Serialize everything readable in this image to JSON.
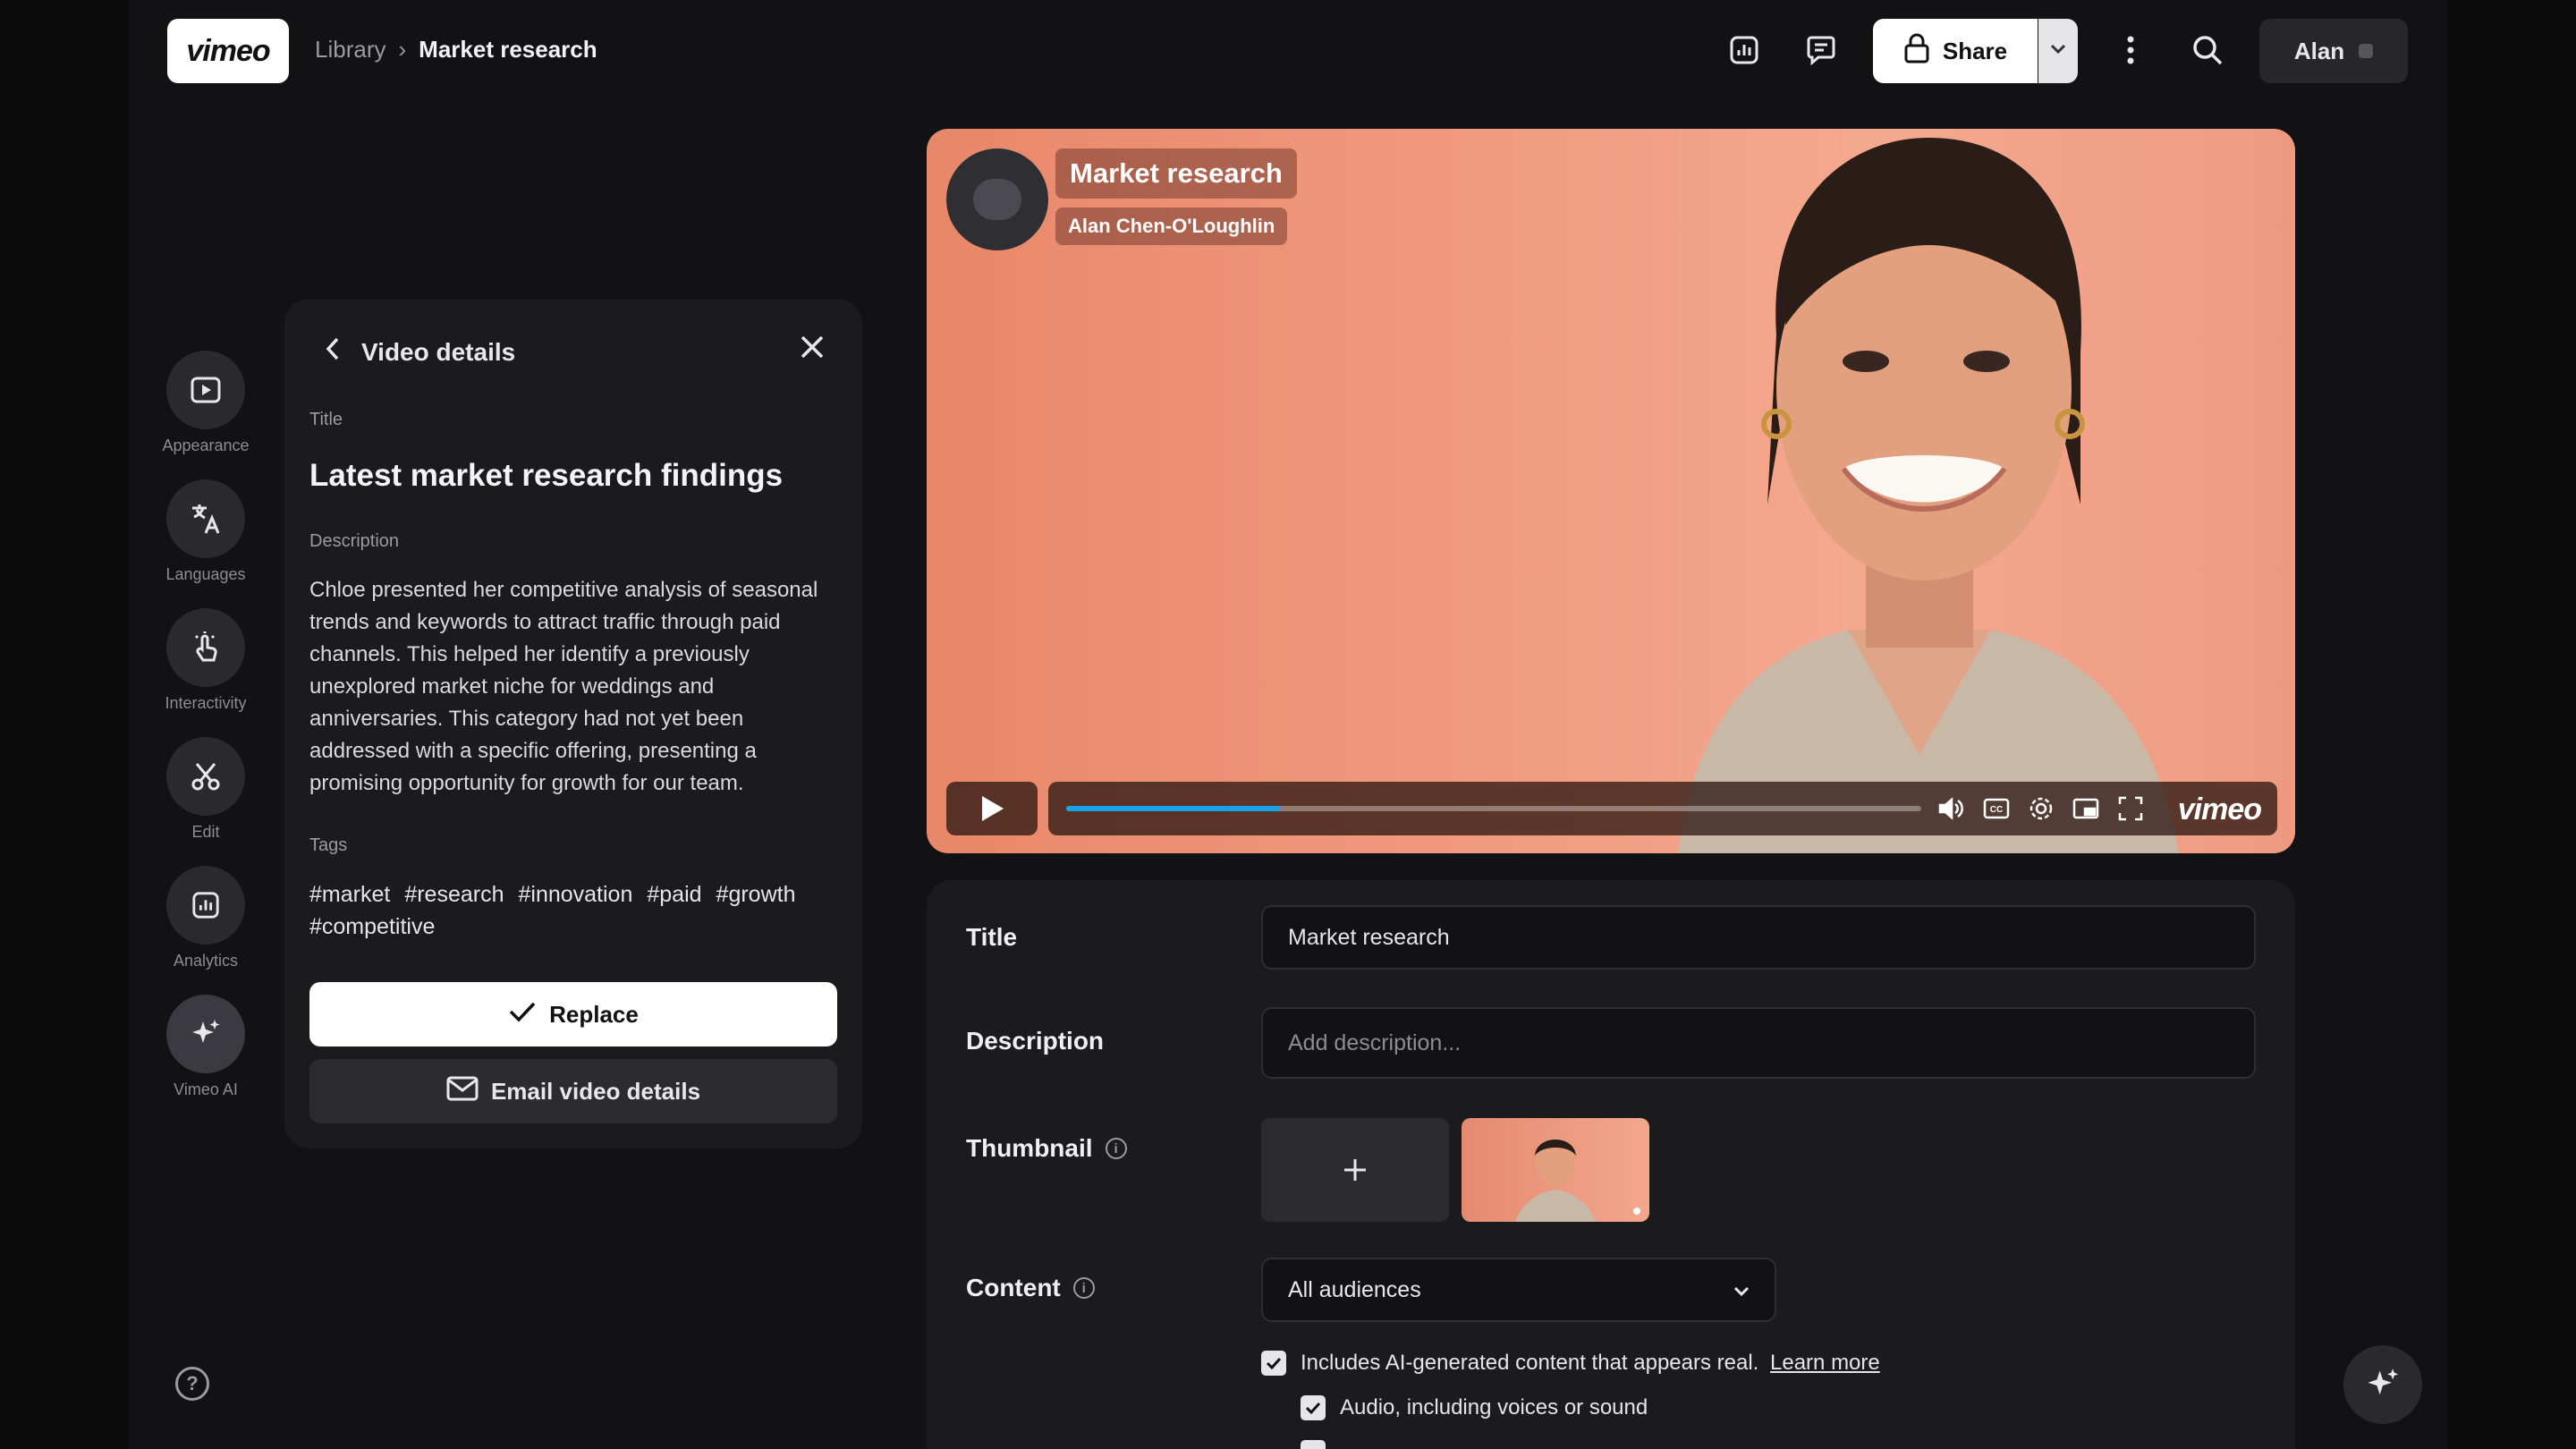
{
  "header": {
    "logo_text": "vimeo",
    "breadcrumb_root": "Library",
    "breadcrumb_current": "Market research",
    "share_label": "Share",
    "user_name": "Alan"
  },
  "rail": {
    "items": [
      {
        "label": "Appearance",
        "icon": "play-square-icon"
      },
      {
        "label": "Languages",
        "icon": "translate-icon"
      },
      {
        "label": "Interactivity",
        "icon": "pointer-click-icon"
      },
      {
        "label": "Edit",
        "icon": "scissors-icon"
      },
      {
        "label": "Analytics",
        "icon": "chart-icon"
      },
      {
        "label": "Vimeo AI",
        "icon": "sparkle-icon"
      }
    ]
  },
  "panel": {
    "heading": "Video details",
    "title_label": "Title",
    "title": "Latest market research findings",
    "description_label": "Description",
    "description": "Chloe presented her competitive analysis of seasonal trends and keywords to attract traffic through paid channels. This helped her identify a previously unexplored market niche for weddings and anniversaries. This category had not yet been addressed with a specific offering, presenting a promising opportunity for growth for our team.",
    "tags_label": "Tags",
    "tags": [
      "#market",
      "#research",
      "#innovation",
      "#paid",
      "#growth",
      "#competitive"
    ],
    "replace_label": "Replace",
    "email_label": "Email video details"
  },
  "video": {
    "title": "Market research",
    "author": "Alan Chen-O'Loughlin",
    "progress": 0.25,
    "brand": "vimeo",
    "accent_color": "#17a2ea"
  },
  "form": {
    "title_label": "Title",
    "title_value": "Market research",
    "description_label": "Description",
    "description_placeholder": "Add description...",
    "thumbnail_label": "Thumbnail",
    "content_label": "Content",
    "content_value": "All audiences",
    "ai_check_label": "Includes AI-generated content that appears real.",
    "ai_check_link": "Learn more",
    "audio_check_label": "Audio, including voices or sound"
  }
}
